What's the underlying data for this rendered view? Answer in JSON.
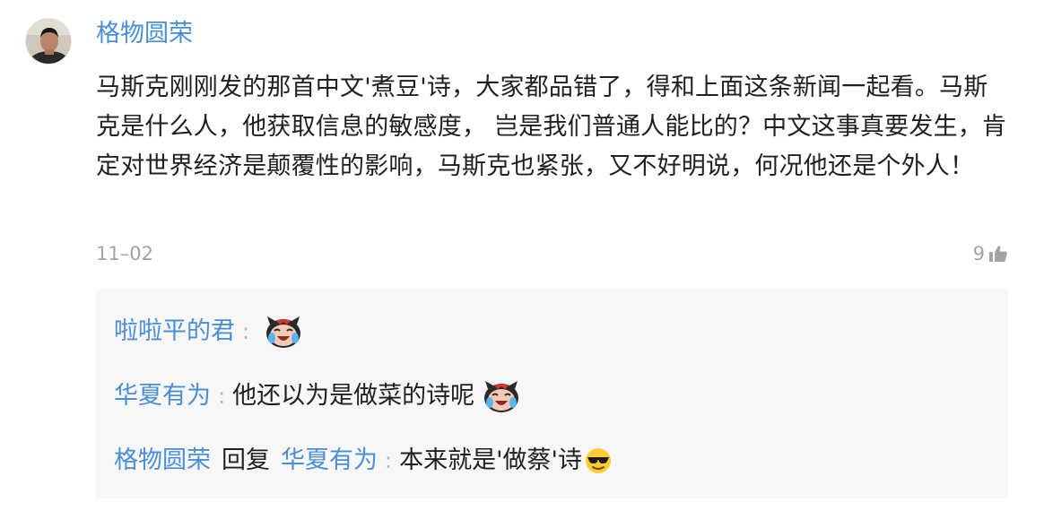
{
  "comment": {
    "author": "格物圆荣",
    "text": "马斯克刚刚发的那首中文'煮豆'诗，大家都品错了，得和上面这条新闻一起看。马斯克是什么人，他获取信息的敏感度， 岂是我们普通人能比的？中文这事真要发生，肯定对世界经济是颠覆性的影响，马斯克也紧张，又不好明说，何况他还是个外人！",
    "date": "11–02",
    "likes": "9",
    "like_icon": "thumbs-up-icon"
  },
  "replies": [
    {
      "author": "啦啦平的君",
      "separator": ":",
      "text": "",
      "emoji": "laughing-tears-devil-emoji"
    },
    {
      "author": "华夏有为",
      "separator": ":",
      "text": "他还以为是做菜的诗呢",
      "emoji": "laughing-tears-devil-emoji"
    },
    {
      "author": "格物圆荣",
      "reply_word": "回复",
      "reply_to": "华夏有为",
      "separator": ":",
      "text": "本来就是'做蔡'诗",
      "emoji": "sunglasses-emoji"
    }
  ]
}
